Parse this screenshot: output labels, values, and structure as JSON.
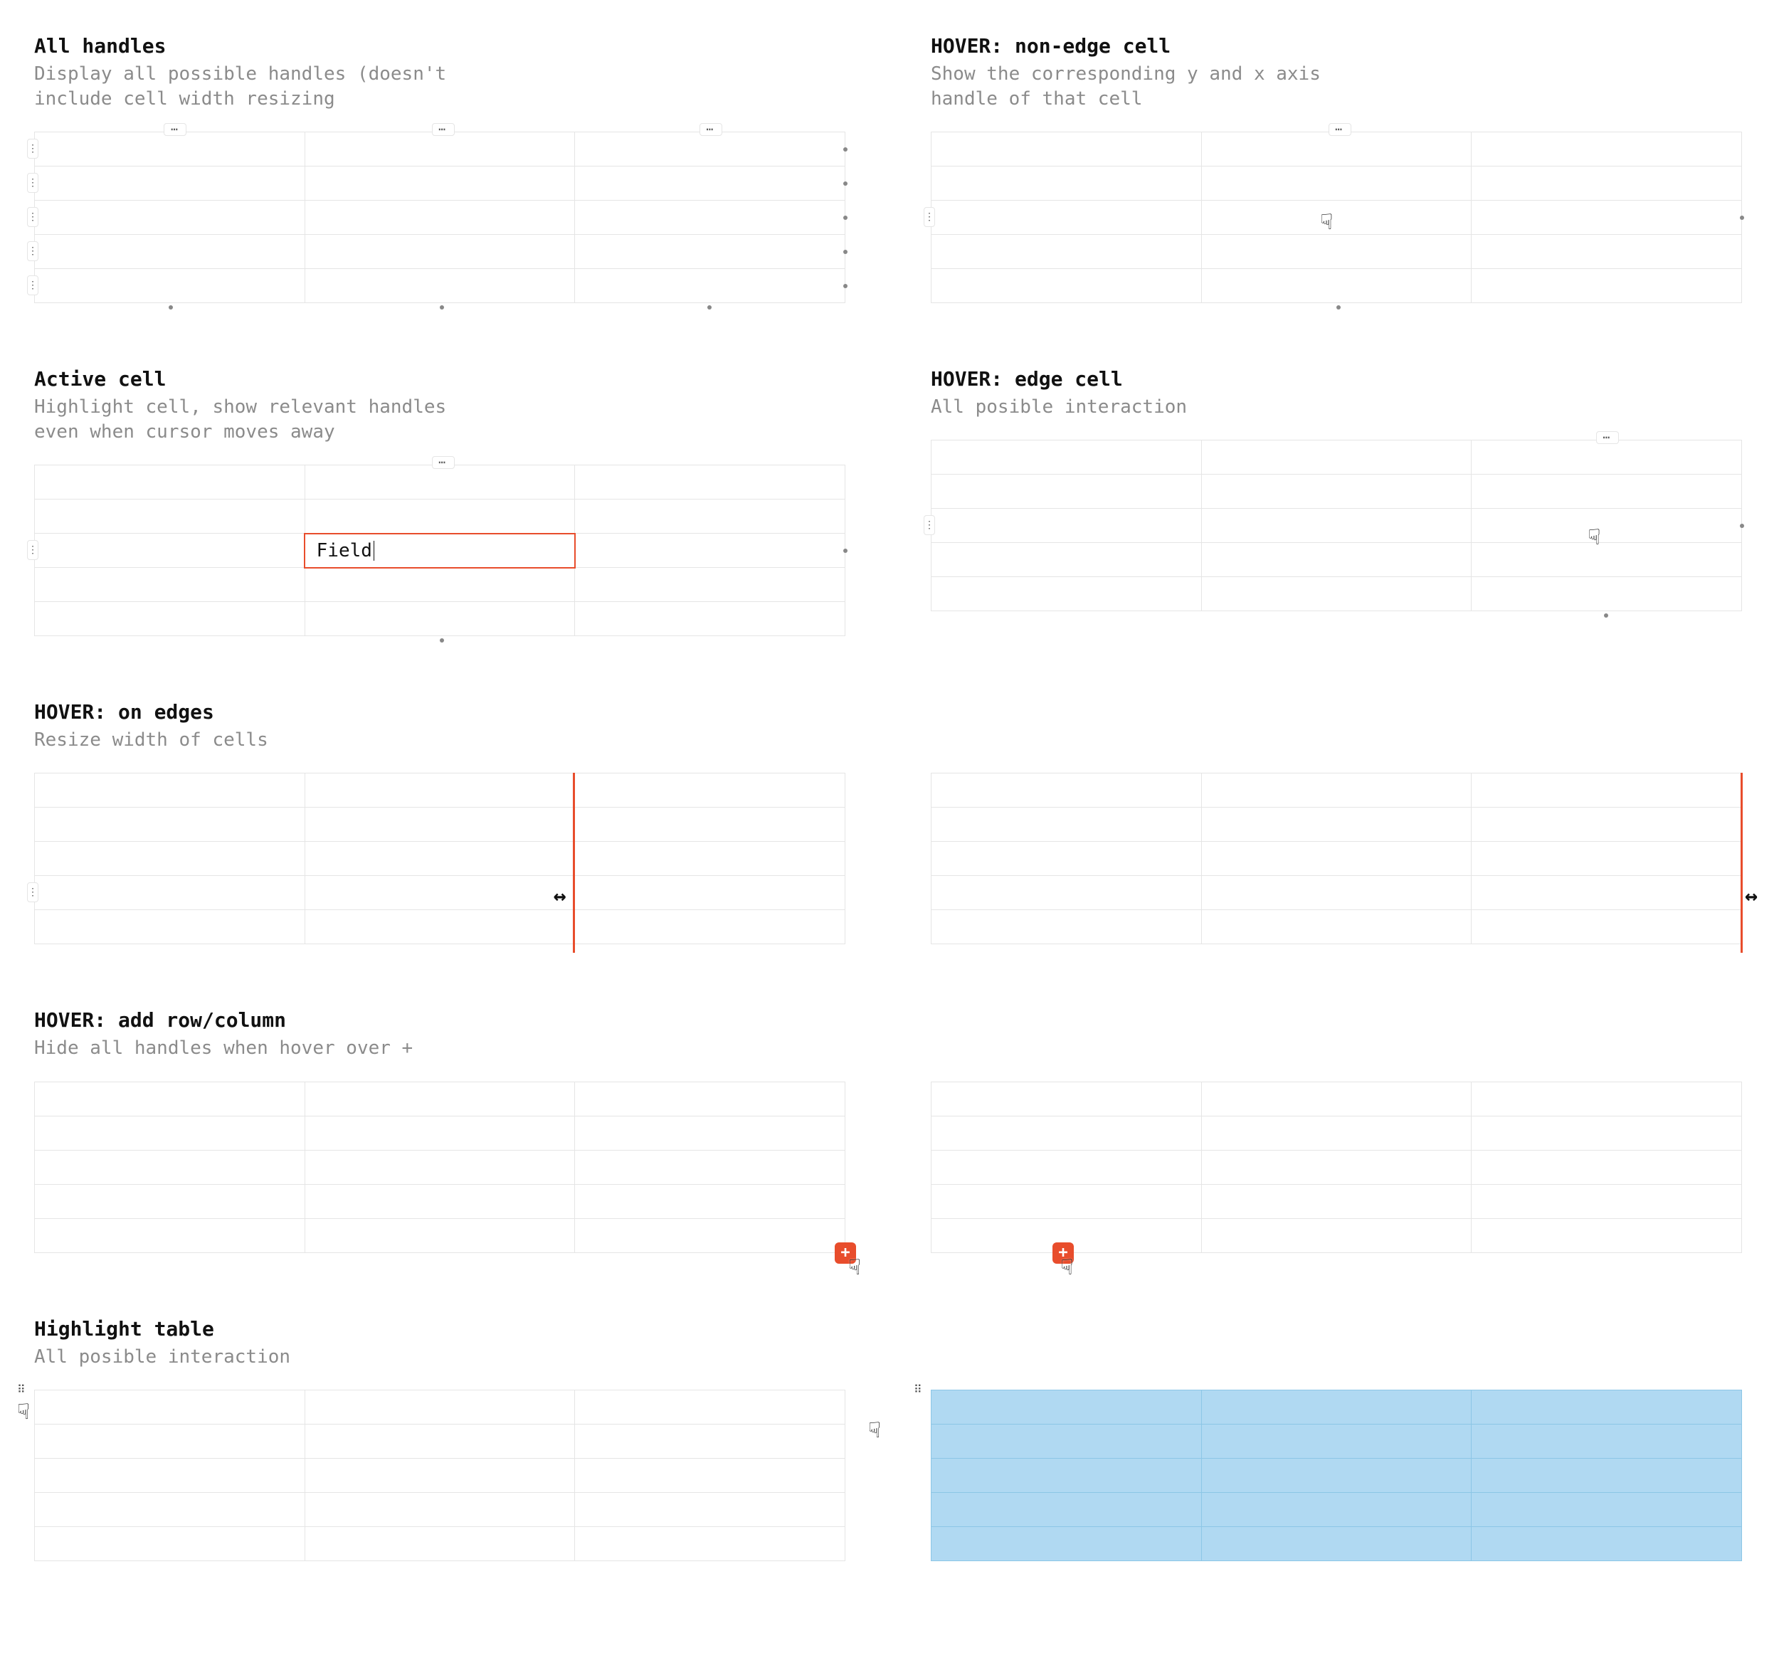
{
  "sections": {
    "all_handles": {
      "title": "All handles",
      "sub": "Display all possible handles (doesn't include cell width resizing"
    },
    "non_edge": {
      "title": "HOVER: non-edge cell",
      "sub": "Show the corresponding y and x axis handle of that cell"
    },
    "active": {
      "title": "Active cell",
      "sub": "Highlight cell, show relevant handles even when cursor moves away"
    },
    "edge": {
      "title": "HOVER: edge cell",
      "sub": "All posible interaction"
    },
    "on_edges": {
      "title": "HOVER: on edges",
      "sub": "Resize width of cells"
    },
    "add": {
      "title": "HOVER: add row/column",
      "sub": "Hide all handles when hover over +"
    },
    "highlight": {
      "title": "Highlight table",
      "sub": "All posible interaction"
    }
  },
  "active_cell_value": "Field",
  "glyphs": {
    "row_handle": "⋮",
    "col_handle": "⋯",
    "plus": "+",
    "move": "⠿",
    "hand_cursor": "☟",
    "resize_cursor": "↔"
  }
}
